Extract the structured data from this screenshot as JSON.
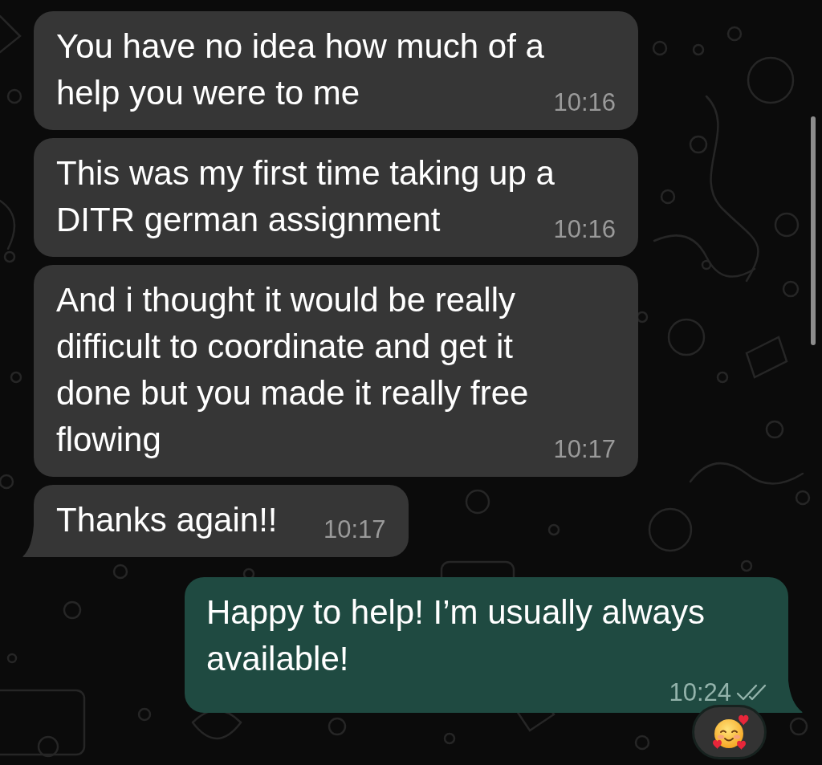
{
  "messages": [
    {
      "kind": "incoming",
      "text": "You have no idea how much of a help you were to me",
      "time": "10:16",
      "tail": false,
      "reacted": false
    },
    {
      "kind": "incoming",
      "text": "This was my first time taking up a DITR german assignment",
      "time": "10:16",
      "tail": false,
      "reacted": false
    },
    {
      "kind": "incoming",
      "text": "And i thought it would be really difficult to coordinate and get it done but you made it really free flowing",
      "time": "10:17",
      "tail": false,
      "reacted": false
    },
    {
      "kind": "incoming",
      "text": "Thanks again!!",
      "time": "10:17",
      "tail": true,
      "reacted": false
    },
    {
      "kind": "outgoing",
      "text": "Happy to help! I’m usually always available!",
      "time": "10:24",
      "tail": true,
      "read": false,
      "reacted": true
    }
  ]
}
